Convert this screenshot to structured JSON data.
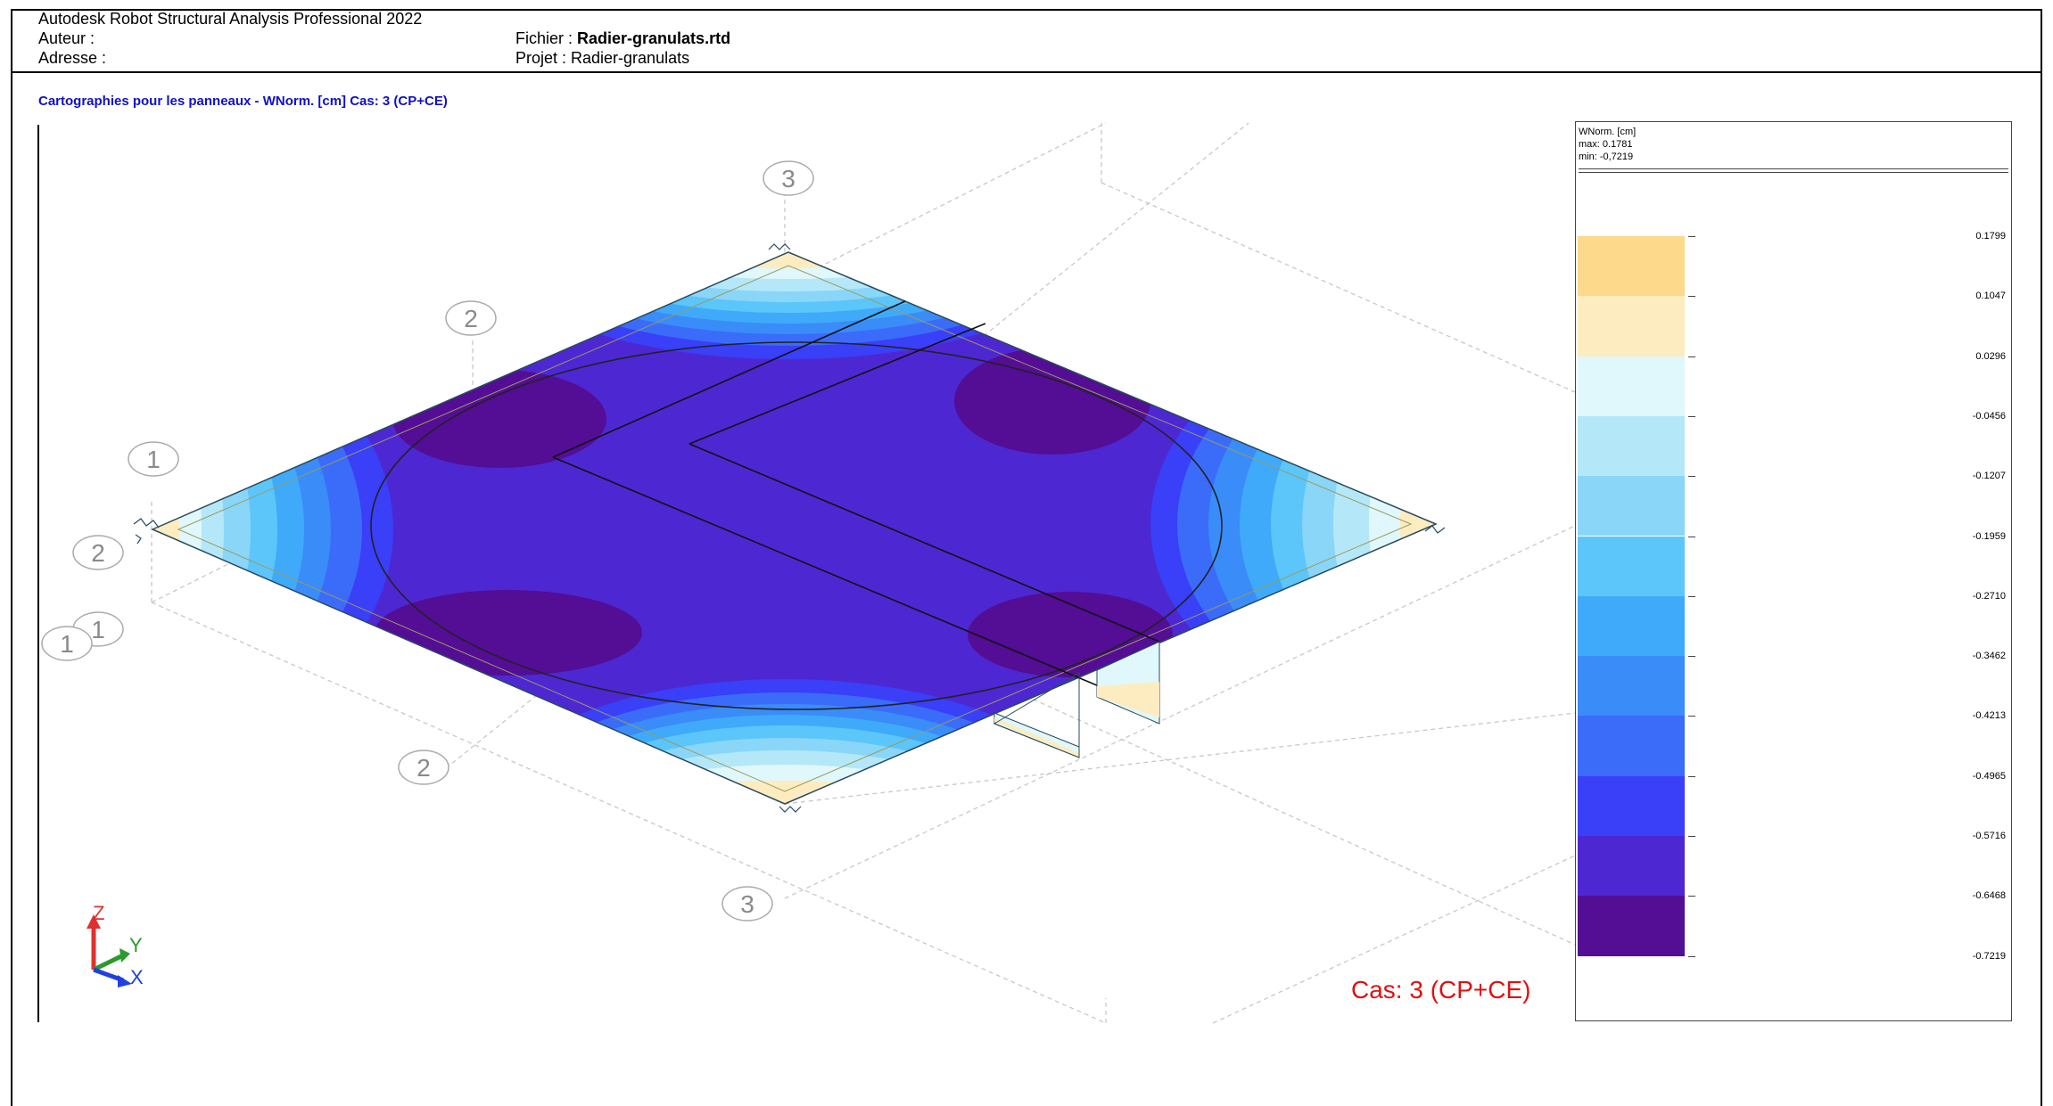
{
  "header": {
    "app": "Autodesk Robot Structural Analysis Professional 2022",
    "auteur_label": "Auteur :",
    "adresse_label": "Adresse :",
    "fichier_label": "Fichier :",
    "fichier_value": "Radier-granulats.rtd",
    "projet": "Projet : Radier-granulats"
  },
  "map_title": "Cartographies pour les panneaux - WNorm. [cm] Cas: 3 (CP+CE)",
  "legend": {
    "title": "WNorm. [cm]",
    "max": "max: 0.1781",
    "min": "min: -0,7219",
    "bands": [
      {
        "value": "0.1799",
        "color": "#fcd98b"
      },
      {
        "value": "0.1047",
        "color": "#fdecc0"
      },
      {
        "value": "0.0296",
        "color": "#e0f8fb"
      },
      {
        "value": "-0.0456",
        "color": "#b4e8f9"
      },
      {
        "value": "-0.1207",
        "color": "#8ad6f8"
      },
      {
        "value": "-0.1959",
        "color": "#5cc6fb"
      },
      {
        "value": "-0.2710",
        "color": "#3faafa"
      },
      {
        "value": "-0.3462",
        "color": "#3a8cf8"
      },
      {
        "value": "-0.4213",
        "color": "#3b6cf9"
      },
      {
        "value": "-0.4965",
        "color": "#3a3ff8"
      },
      {
        "value": "-0.5716",
        "color": "#4d28d2"
      },
      {
        "value": "-0.6468",
        "color": "#540d95"
      },
      {
        "value": "-0.7219",
        "color": ""
      }
    ]
  },
  "grid_labels": {
    "three_top": "3",
    "two_upper": "2",
    "one_upper": "1",
    "two_left": "2",
    "one_mid": "1",
    "one_low": "1",
    "two_bottom": "2",
    "three_bottom": "3"
  },
  "axes": {
    "z": "Z",
    "y": "Y",
    "x": "X"
  },
  "case_label": "Cas: 3 (CP+CE)",
  "colors": {
    "title_blue": "#1010c8",
    "case_red": "#e01010",
    "slab_main": "#4d28d2",
    "slab_dark": "#540d95"
  }
}
